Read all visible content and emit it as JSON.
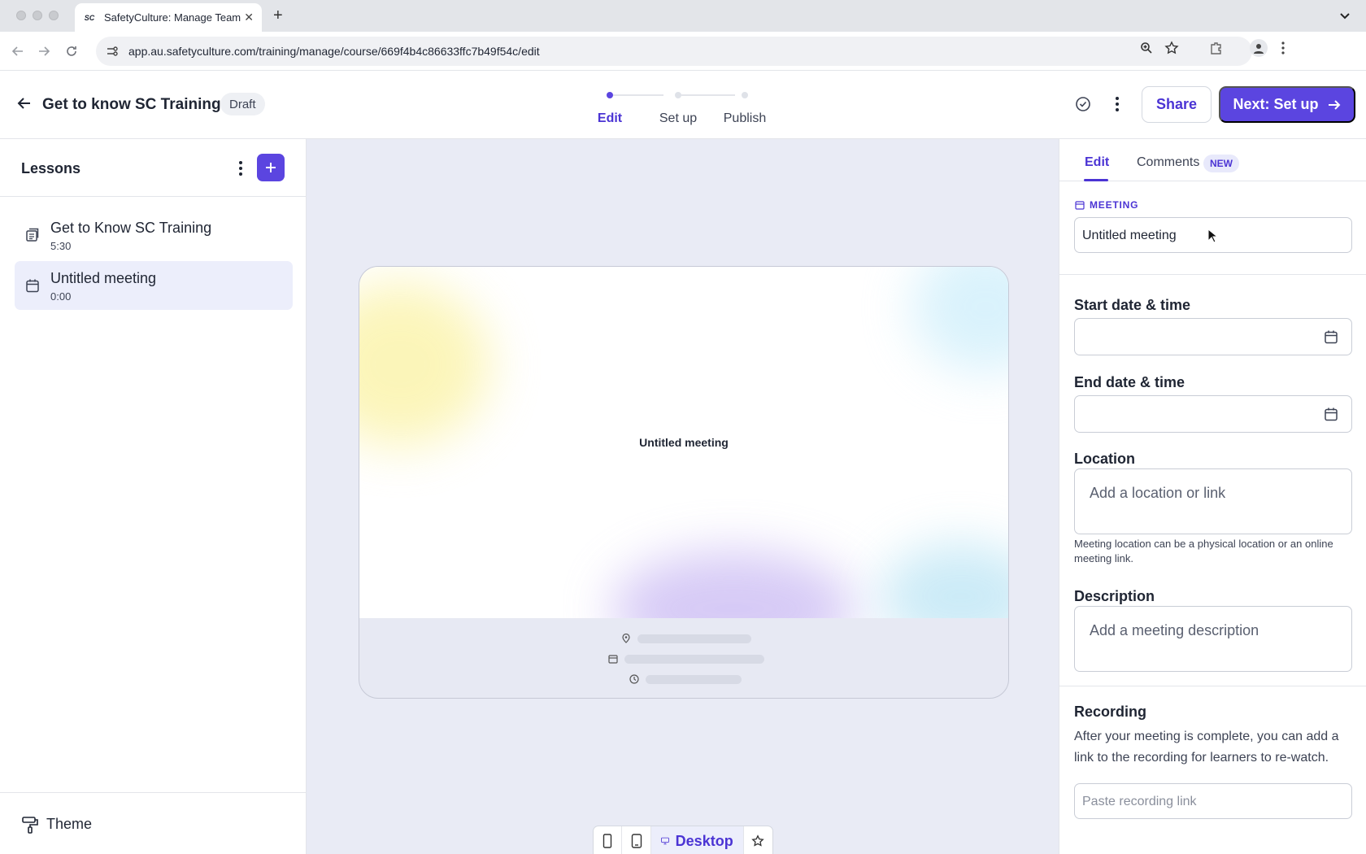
{
  "browser": {
    "tab_title": "SafetyCulture: Manage Teams",
    "favicon_text": "SC",
    "url": "app.au.safetyculture.com/training/manage/course/669f4b4c86633ffc7b49f54c/edit"
  },
  "header": {
    "course_title": "Get to know SC Training",
    "status_badge": "Draft",
    "steps": [
      "Edit",
      "Set up",
      "Publish"
    ],
    "active_step": "Edit",
    "share_label": "Share",
    "next_label": "Next: Set up"
  },
  "sidebar": {
    "title": "Lessons",
    "lessons": [
      {
        "name": "Get to Know SC Training",
        "duration": "5:30",
        "icon": "document-icon"
      },
      {
        "name": "Untitled meeting",
        "duration": "0:00",
        "icon": "calendar-icon"
      }
    ],
    "footer_label": "Theme"
  },
  "canvas": {
    "card_title": "Untitled meeting",
    "device_options": [
      "mobile",
      "tablet",
      "Desktop",
      "favorite"
    ],
    "active_device": "Desktop"
  },
  "panel": {
    "tabs": {
      "edit": "Edit",
      "comments": "Comments",
      "new_badge": "NEW"
    },
    "section_label": "MEETING",
    "meeting_title_value": "Untitled meeting",
    "start_label": "Start date & time",
    "end_label": "End date & time",
    "location_label": "Location",
    "location_placeholder": "Add a location or link",
    "location_helper": "Meeting location can be a physical location or an online meeting link.",
    "description_label": "Description",
    "description_placeholder": "Add a meeting description",
    "recording_label": "Recording",
    "recording_text": "After your meeting is complete, you can add a link to the recording for learners to re-watch.",
    "recording_placeholder": "Paste recording link"
  },
  "colors": {
    "accent": "#5b45e0",
    "canvas_bg": "#e9ebf5",
    "selected_bg": "#eceefb"
  }
}
